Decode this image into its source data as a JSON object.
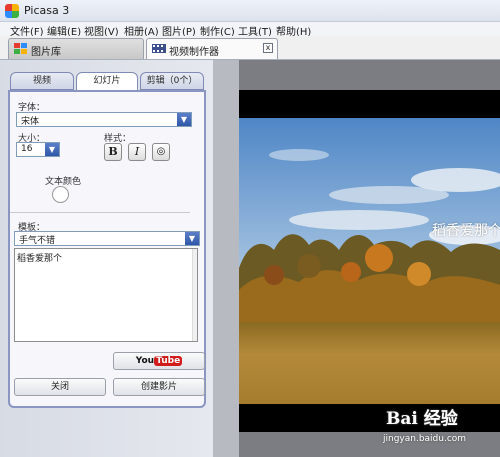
{
  "window": {
    "title": "Picasa 3"
  },
  "menu": [
    "文件(F)",
    "编辑(E)",
    "视图(V)",
    "相册(A)",
    "图片(P)",
    "制作(C)",
    "工具(T)",
    "帮助(H)"
  ],
  "tabs": {
    "library": "图片库",
    "movie_maker": "视频制作器",
    "close_symbol": "x"
  },
  "panel_tabs": {
    "video": "视频",
    "slide": "幻灯片",
    "clips": "剪辑（0个）"
  },
  "slide": {
    "font_label": "字体：",
    "font_value": "宋体",
    "size_label": "大小：",
    "size_value": "16",
    "style_label": "样式：",
    "bold": "B",
    "italic": "I",
    "outline": "◎",
    "text_color_label": "文本颜色",
    "template_label": "模板：",
    "template_value": "手气不错",
    "text_content": "稻香爱那个"
  },
  "buttons": {
    "youtube_you": "You",
    "youtube_tube": "Tube",
    "close": "关闭",
    "create_movie": "创建影片"
  },
  "preview": {
    "overlay_text": "稻香爱那个"
  },
  "watermark": {
    "main": "Bai 经验",
    "url": "jingyan.baidu.com"
  },
  "colors": {
    "accent": "#2f57a8",
    "panel_border": "#8a95c2",
    "youtube_red": "#d21c1c"
  }
}
